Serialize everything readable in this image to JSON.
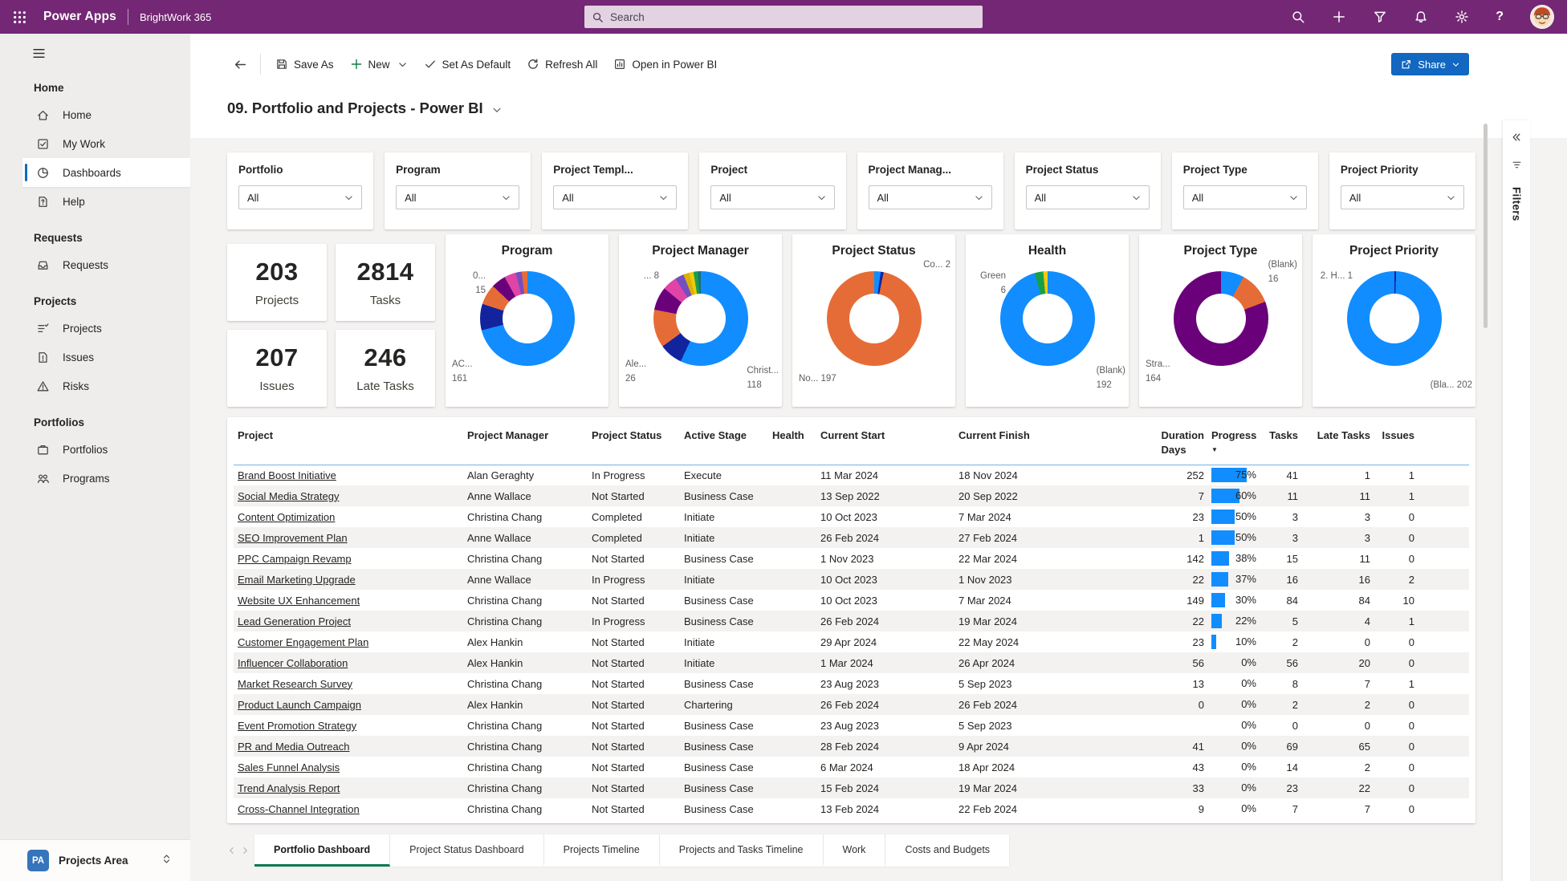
{
  "topbar": {
    "app_name": "Power Apps",
    "environment": "BrightWork 365",
    "search_placeholder": "Search"
  },
  "toolbar": {
    "save_as": "Save As",
    "new": "New",
    "set_as_default": "Set As Default",
    "refresh_all": "Refresh All",
    "open_in_power_bi": "Open in Power BI",
    "share": "Share"
  },
  "page_title": "09. Portfolio and Projects - Power BI",
  "sidebar": {
    "sections": [
      {
        "header": "Home",
        "items": [
          {
            "label": "Home",
            "icon": "home"
          },
          {
            "label": "My Work",
            "icon": "mywork"
          },
          {
            "label": "Dashboards",
            "icon": "dashboards",
            "selected": true
          },
          {
            "label": "Help",
            "icon": "help"
          }
        ]
      },
      {
        "header": "Requests",
        "items": [
          {
            "label": "Requests",
            "icon": "requests"
          }
        ]
      },
      {
        "header": "Projects",
        "items": [
          {
            "label": "Projects",
            "icon": "projects"
          },
          {
            "label": "Issues",
            "icon": "issues"
          },
          {
            "label": "Risks",
            "icon": "risks"
          }
        ]
      },
      {
        "header": "Portfolios",
        "items": [
          {
            "label": "Portfolios",
            "icon": "portfolios"
          },
          {
            "label": "Programs",
            "icon": "programs"
          }
        ]
      }
    ],
    "footer": {
      "badge": "PA",
      "label": "Projects Area"
    }
  },
  "filters": {
    "cards": [
      {
        "label": "Portfolio",
        "value": "All"
      },
      {
        "label": "Program",
        "value": "All"
      },
      {
        "label": "Project Templ...",
        "value": "All"
      },
      {
        "label": "Project",
        "value": "All"
      },
      {
        "label": "Project Manag...",
        "value": "All"
      },
      {
        "label": "Project Status",
        "value": "All"
      },
      {
        "label": "Project Type",
        "value": "All"
      },
      {
        "label": "Project Priority",
        "value": "All"
      }
    ]
  },
  "kpis": [
    {
      "value": "203",
      "label": "Projects"
    },
    {
      "value": "2814",
      "label": "Tasks"
    },
    {
      "value": "207",
      "label": "Issues"
    },
    {
      "value": "246",
      "label": "Late Tasks"
    }
  ],
  "chart_data": [
    {
      "type": "donut",
      "title": "Program",
      "slices": [
        {
          "color": "#118DFF",
          "pct": 71
        },
        {
          "color": "#12239E",
          "pct": 9
        },
        {
          "color": "#E66C37",
          "pct": 7
        },
        {
          "color": "#6B007B",
          "pct": 5
        },
        {
          "color": "#E044A7",
          "pct": 4
        },
        {
          "color": "#744EC2",
          "pct": 2
        },
        {
          "color": "#E66C37",
          "pct": 2
        }
      ],
      "callouts": [
        {
          "text": "0...\n15",
          "pos": "tl"
        },
        {
          "text": "AC...\n161",
          "pos": "bl"
        }
      ]
    },
    {
      "type": "donut",
      "title": "Project Manager",
      "slices": [
        {
          "color": "#118DFF",
          "pct": 57
        },
        {
          "color": "#12239E",
          "pct": 8
        },
        {
          "color": "#E66C37",
          "pct": 13
        },
        {
          "color": "#6B007B",
          "pct": 8
        },
        {
          "color": "#E044A7",
          "pct": 5
        },
        {
          "color": "#744EC2",
          "pct": 3
        },
        {
          "color": "#D9B300",
          "pct": 2
        },
        {
          "color": "#F2C80F",
          "pct": 1.5
        },
        {
          "color": "#18A048",
          "pct": 1.5
        },
        {
          "color": "#197278",
          "pct": 1
        }
      ],
      "callouts": [
        {
          "text": "... 8",
          "pos": "tl"
        },
        {
          "text": "Ale...\n26",
          "pos": "bl"
        },
        {
          "text": "Christ...\n118",
          "pos": "br"
        }
      ]
    },
    {
      "type": "donut",
      "title": "Project Status",
      "slices": [
        {
          "color": "#118DFF",
          "pct": 2.2
        },
        {
          "color": "#12239E",
          "pct": 1
        },
        {
          "color": "#E66C37",
          "pct": 96.8
        }
      ],
      "callouts": [
        {
          "text": "Co... 2",
          "pos": "tr"
        },
        {
          "text": "No... 197",
          "pos": "bl"
        }
      ]
    },
    {
      "type": "donut",
      "title": "Health",
      "slices": [
        {
          "color": "#118DFF",
          "pct": 95.5
        },
        {
          "color": "#18A048",
          "pct": 3
        },
        {
          "color": "#F2C80F",
          "pct": 1.5
        }
      ],
      "callouts": [
        {
          "text": "Green\n6",
          "pos": "tl"
        },
        {
          "text": "(Blank)\n192",
          "pos": "br"
        }
      ]
    },
    {
      "type": "donut",
      "title": "Project Type",
      "slices": [
        {
          "color": "#118DFF",
          "pct": 7.9
        },
        {
          "color": "#E66C37",
          "pct": 11.3
        },
        {
          "color": "#6B007B",
          "pct": 80.8
        }
      ],
      "callouts": [
        {
          "text": "(Blank)\n16",
          "pos": "tr"
        },
        {
          "text": "Stra...\n164",
          "pos": "bl"
        }
      ]
    },
    {
      "type": "donut",
      "title": "Project Priority",
      "slices": [
        {
          "color": "#12239E",
          "pct": 0.6
        },
        {
          "color": "#118DFF",
          "pct": 99.4
        }
      ],
      "callouts": [
        {
          "text": "2. H... 1",
          "pos": "tl"
        },
        {
          "text": "(Bla... 202",
          "pos": "br"
        }
      ]
    }
  ],
  "table": {
    "columns": [
      "Project",
      "Project Manager",
      "Project Status",
      "Active Stage",
      "Health",
      "Current Start",
      "Current Finish",
      "Duration Days",
      "Progress",
      "Tasks",
      "Late Tasks",
      "Issues"
    ],
    "sorted_column": "Progress",
    "rows": [
      [
        "Brand Boost Initiative",
        "Alan Geraghty",
        "In Progress",
        "Execute",
        "",
        "11 Mar 2024",
        "18 Nov 2024",
        "252",
        75,
        "41",
        "1",
        "1"
      ],
      [
        "Social Media Strategy",
        "Anne Wallace",
        "Not Started",
        "Business Case",
        "",
        "13 Sep 2022",
        "20 Sep 2022",
        "7",
        60,
        "11",
        "11",
        "1"
      ],
      [
        "Content Optimization",
        "Christina Chang",
        "Completed",
        "Initiate",
        "",
        "10 Oct 2023",
        "7 Mar 2024",
        "23",
        50,
        "3",
        "3",
        "0"
      ],
      [
        "SEO Improvement Plan",
        "Anne Wallace",
        "Completed",
        "Initiate",
        "",
        "26 Feb 2024",
        "27 Feb 2024",
        "1",
        50,
        "3",
        "3",
        "0"
      ],
      [
        "PPC Campaign Revamp",
        "Christina Chang",
        "Not Started",
        "Business Case",
        "",
        "1 Nov 2023",
        "22 Mar 2024",
        "142",
        38,
        "15",
        "11",
        "0"
      ],
      [
        "Email Marketing Upgrade",
        "Anne Wallace",
        "In Progress",
        "Initiate",
        "",
        "10 Oct 2023",
        "1 Nov 2023",
        "22",
        37,
        "16",
        "16",
        "2"
      ],
      [
        "Website UX Enhancement",
        "Christina Chang",
        "Not Started",
        "Business Case",
        "",
        "10 Oct 2023",
        "7 Mar 2024",
        "149",
        30,
        "84",
        "84",
        "10"
      ],
      [
        "Lead Generation Project",
        "Christina Chang",
        "In Progress",
        "Business Case",
        "",
        "26 Feb 2024",
        "19 Mar 2024",
        "22",
        22,
        "5",
        "4",
        "1"
      ],
      [
        "Customer Engagement Plan",
        "Alex Hankin",
        "Not Started",
        "Initiate",
        "",
        "29 Apr 2024",
        "22 May 2024",
        "23",
        10,
        "2",
        "0",
        "0"
      ],
      [
        "Influencer Collaboration",
        "Alex Hankin",
        "Not Started",
        "Initiate",
        "",
        "1 Mar 2024",
        "26 Apr 2024",
        "56",
        0,
        "56",
        "20",
        "0"
      ],
      [
        "Market Research Survey",
        "Christina Chang",
        "Not Started",
        "Business Case",
        "",
        "23 Aug 2023",
        "5 Sep 2023",
        "13",
        0,
        "8",
        "7",
        "1"
      ],
      [
        "Product Launch Campaign",
        "Alex Hankin",
        "Not Started",
        "Chartering",
        "",
        "26 Feb 2024",
        "26 Feb 2024",
        "0",
        0,
        "2",
        "2",
        "0"
      ],
      [
        "Event Promotion Strategy",
        "Christina Chang",
        "Not Started",
        "Business Case",
        "",
        "23 Aug 2023",
        "5 Sep 2023",
        "",
        0,
        "0",
        "0",
        "0"
      ],
      [
        "PR and Media Outreach",
        "Christina Chang",
        "Not Started",
        "Business Case",
        "",
        "28 Feb 2024",
        "9 Apr 2024",
        "41",
        0,
        "69",
        "65",
        "0"
      ],
      [
        "Sales Funnel Analysis",
        "Christina Chang",
        "Not Started",
        "Business Case",
        "",
        "6 Mar 2024",
        "18 Apr 2024",
        "43",
        0,
        "14",
        "2",
        "0"
      ],
      [
        "Trend Analysis Report",
        "Christina Chang",
        "Not Started",
        "Business Case",
        "",
        "15 Feb 2024",
        "19 Mar 2024",
        "33",
        0,
        "23",
        "22",
        "0"
      ],
      [
        "Cross-Channel Integration",
        "Christina Chang",
        "Not Started",
        "Business Case",
        "",
        "13 Feb 2024",
        "22 Feb 2024",
        "9",
        0,
        "7",
        "7",
        "0"
      ]
    ]
  },
  "tabs": [
    {
      "label": "Portfolio Dashboard",
      "active": true
    },
    {
      "label": "Project Status Dashboard",
      "active": false
    },
    {
      "label": "Projects Timeline",
      "active": false
    },
    {
      "label": "Projects and Tasks Timeline",
      "active": false
    },
    {
      "label": "Work",
      "active": false
    },
    {
      "label": "Costs and Budgets",
      "active": false
    }
  ],
  "filters_panel": {
    "label": "Filters"
  }
}
